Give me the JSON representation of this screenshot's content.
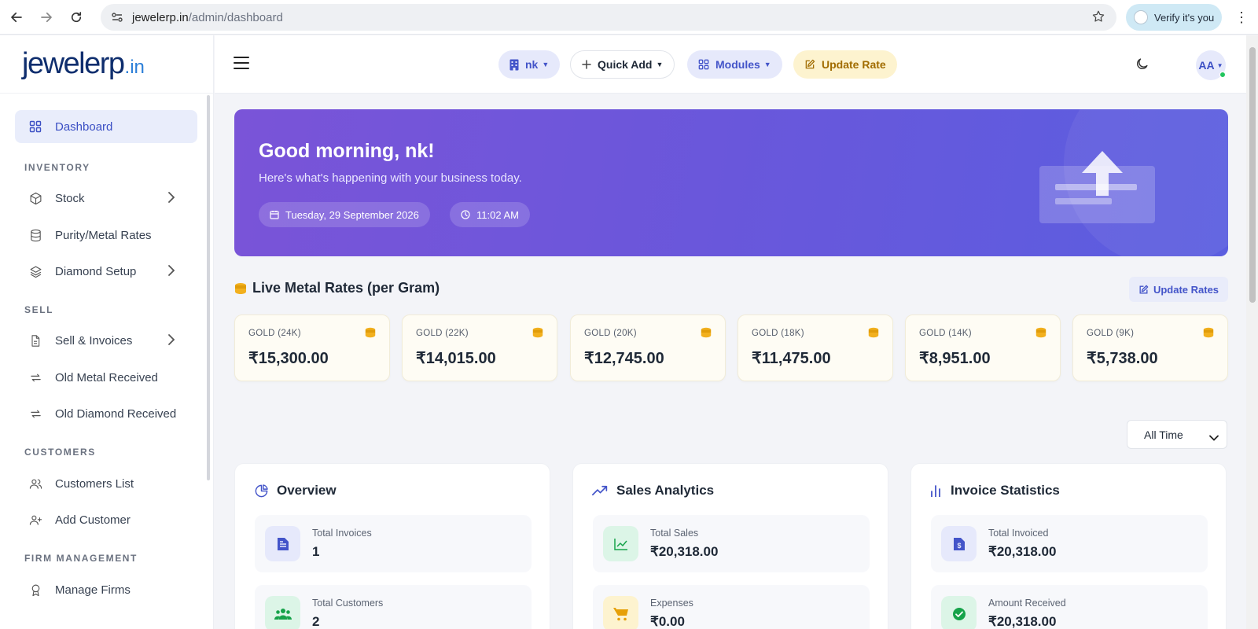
{
  "browser": {
    "url_domain": "jewelerp.in",
    "url_path": "/admin/dashboard",
    "verify_label": "Verify it's you"
  },
  "logo": {
    "word": "jewelerp",
    "tld": ".in"
  },
  "sidebar": {
    "items": [
      {
        "label": "Dashboard",
        "icon": "grid-icon",
        "active": true
      },
      {
        "section": "INVENTORY"
      },
      {
        "label": "Stock",
        "icon": "box-icon",
        "chevron": true
      },
      {
        "label": "Purity/Metal Rates",
        "icon": "database-icon"
      },
      {
        "label": "Diamond Setup",
        "icon": "layers-icon",
        "chevron": true
      },
      {
        "section": "SELL"
      },
      {
        "label": "Sell & Invoices",
        "icon": "document-icon",
        "chevron": true
      },
      {
        "label": "Old Metal Received",
        "icon": "repeat-icon"
      },
      {
        "label": "Old Diamond Received",
        "icon": "repeat-icon"
      },
      {
        "section": "CUSTOMERS"
      },
      {
        "label": "Customers List",
        "icon": "users-icon"
      },
      {
        "label": "Add Customer",
        "icon": "user-plus-icon"
      },
      {
        "section": "FIRM MANAGEMENT"
      },
      {
        "label": "Manage Firms",
        "icon": "award-icon"
      }
    ]
  },
  "topbar": {
    "firm_label": "nk",
    "quick_add_label": "Quick Add",
    "modules_label": "Modules",
    "update_rate_label": "Update Rate",
    "avatar_initials": "AA"
  },
  "hero": {
    "greeting": "Good morning, nk!",
    "subtitle": "Here's what's happening with your business today.",
    "date": "Tuesday, 29 September 2026",
    "time": "11:02 AM"
  },
  "metal_rates": {
    "title": "Live Metal Rates (per Gram)",
    "update_button": "Update Rates",
    "rates": [
      {
        "label": "GOLD (24K)",
        "value": "₹15,300.00"
      },
      {
        "label": "GOLD (22K)",
        "value": "₹14,015.00"
      },
      {
        "label": "GOLD (20K)",
        "value": "₹12,745.00"
      },
      {
        "label": "GOLD (18K)",
        "value": "₹11,475.00"
      },
      {
        "label": "GOLD (14K)",
        "value": "₹8,951.00"
      },
      {
        "label": "GOLD (9K)",
        "value": "₹5,738.00"
      }
    ]
  },
  "period_select": {
    "value": "All Time"
  },
  "panels": [
    {
      "title": "Overview",
      "stats": [
        {
          "label": "Total Invoices",
          "value": "1"
        },
        {
          "label": "Total Customers",
          "value": "2"
        }
      ]
    },
    {
      "title": "Sales Analytics",
      "stats": [
        {
          "label": "Total Sales",
          "value": "₹20,318.00"
        },
        {
          "label": "Expenses",
          "value": "₹0.00"
        }
      ]
    },
    {
      "title": "Invoice Statistics",
      "stats": [
        {
          "label": "Total Invoiced",
          "value": "₹20,318.00"
        },
        {
          "label": "Amount Received",
          "value": "₹20,318.00"
        }
      ]
    }
  ],
  "colors": {
    "accent": "#4354c9",
    "hero_start": "#7a54d8",
    "hero_end": "#5b5ee0",
    "gold": "#f2b01e",
    "success": "#22c55e"
  }
}
